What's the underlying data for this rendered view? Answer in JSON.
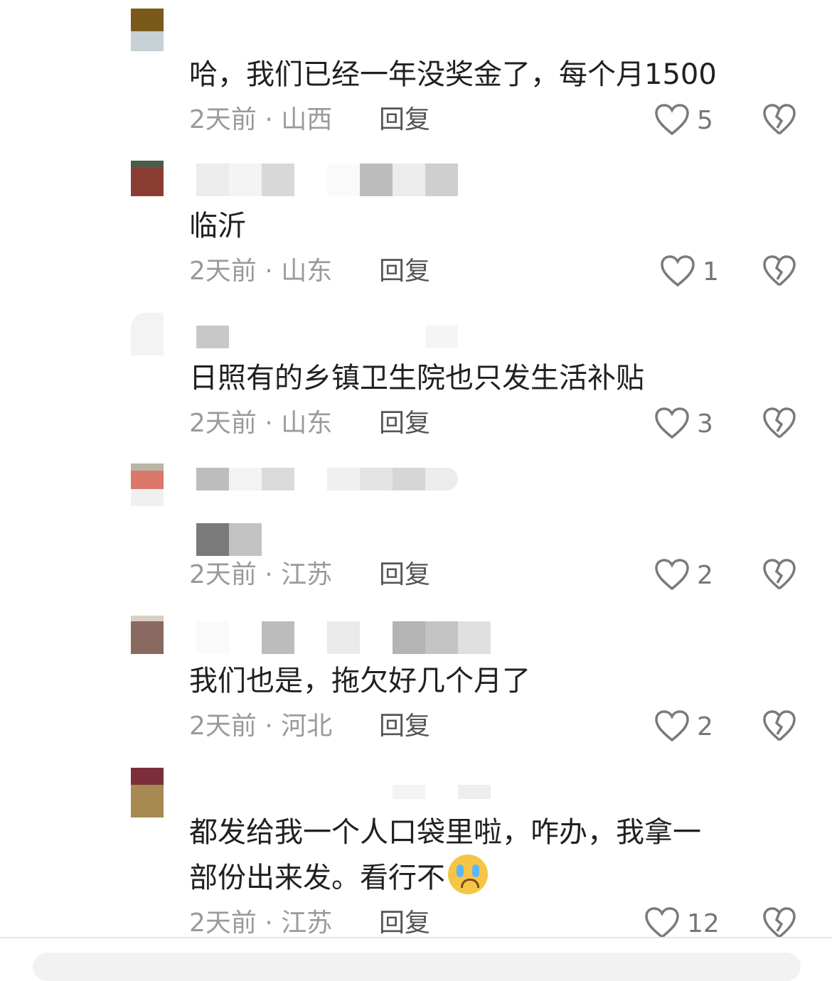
{
  "comments": [
    {
      "text_lines": [
        "哈，我们已经一年没奖金了，每个月1500"
      ],
      "time": "2天前",
      "location": "山西",
      "reply_label": "回复",
      "likes": "5"
    },
    {
      "text_lines": [
        "临沂"
      ],
      "time": "2天前",
      "location": "山东",
      "reply_label": "回复",
      "likes": "1"
    },
    {
      "text_lines": [
        "日照有的乡镇卫生院也只发生活补贴"
      ],
      "time": "2天前",
      "location": "山东",
      "reply_label": "回复",
      "likes": "3"
    },
    {
      "text_lines": [],
      "time": "2天前",
      "location": "江苏",
      "reply_label": "回复",
      "likes": "2"
    },
    {
      "text_lines": [
        "我们也是，拖欠好几个月了"
      ],
      "time": "2天前",
      "location": "河北",
      "reply_label": "回复",
      "likes": "2"
    },
    {
      "text_lines": [
        "都发给我一个人口袋里啦，咋办，我拿一",
        "部份出来发。看行不"
      ],
      "emoji": "loudly-crying-face",
      "time": "2天前",
      "location": "江苏",
      "reply_label": "回复",
      "likes": "12"
    }
  ],
  "icons": {
    "like": "heart-outline-icon",
    "dislike": "broken-heart-icon"
  },
  "colors": {
    "meta_text": "#9a9a9a",
    "reply_text": "#555555",
    "icon_stroke": "#7a7a7a"
  }
}
